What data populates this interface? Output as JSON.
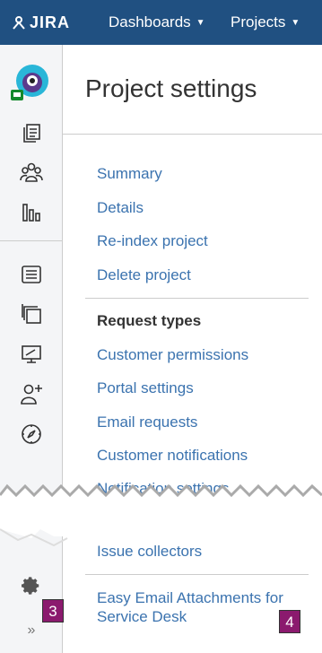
{
  "header": {
    "logo_text": "JIRA",
    "nav": [
      {
        "label": "Dashboards"
      },
      {
        "label": "Projects"
      }
    ]
  },
  "main": {
    "title": "Project settings",
    "links_top": [
      {
        "label": "Summary"
      },
      {
        "label": "Details"
      },
      {
        "label": "Re-index project"
      },
      {
        "label": "Delete project"
      }
    ],
    "section_heading": "Request types",
    "links_mid": [
      {
        "label": "Customer permissions"
      },
      {
        "label": "Portal settings"
      },
      {
        "label": "Email requests"
      },
      {
        "label": "Customer notifications"
      },
      {
        "label": "Notification settings"
      }
    ],
    "links_bottom": [
      {
        "label": "Issue collectors"
      }
    ],
    "easy_email": {
      "line1": "Easy Email Attachments for",
      "line2": "Service Desk"
    }
  },
  "callouts": {
    "badge_3": "3",
    "badge_4": "4"
  },
  "colors": {
    "topbar": "#205081",
    "link": "#3b73af",
    "badge": "#8b1a6e"
  },
  "icons": {
    "sidebar": [
      "project-avatar-icon",
      "issues-icon",
      "team-icon",
      "reports-icon",
      "queues-icon",
      "components-icon",
      "monitor-icon",
      "add-user-icon",
      "compass-icon",
      "settings-icon",
      "expand-icon"
    ]
  }
}
